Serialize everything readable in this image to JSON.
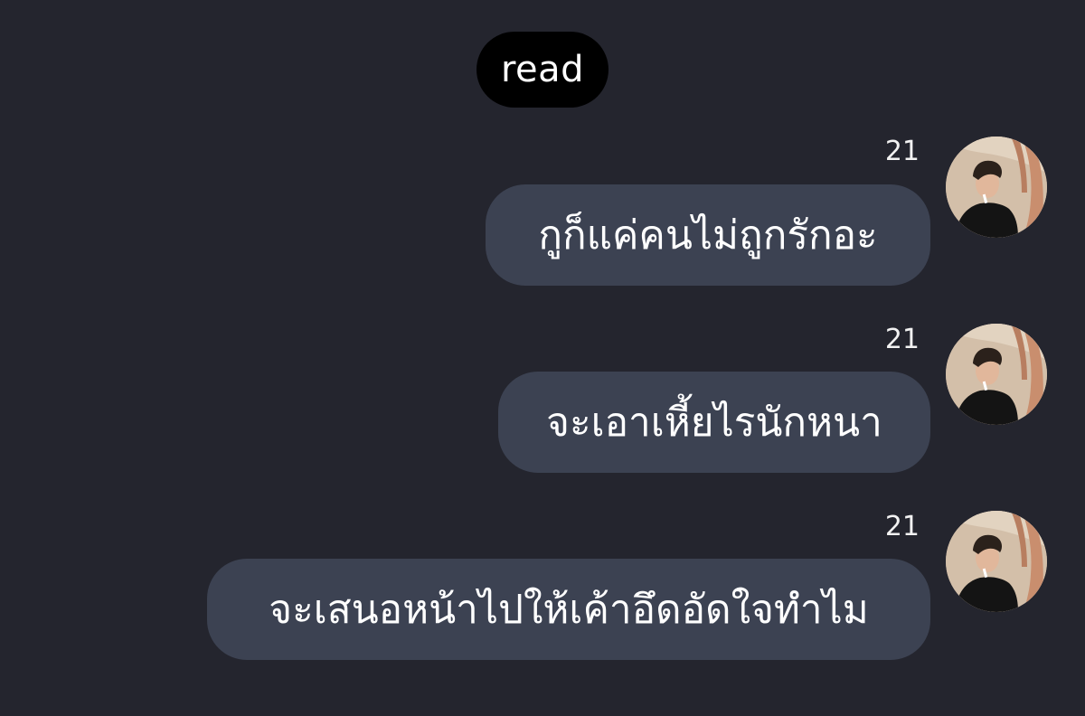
{
  "status": {
    "read_label": "read"
  },
  "messages": [
    {
      "sender": "21",
      "text": "กูก็แค่คนไม่ถูกรักอะ"
    },
    {
      "sender": "21",
      "text": "จะเอาเหี้ยไรนักหนา"
    },
    {
      "sender": "21",
      "text": "จะเสนอหน้าไปให้เค้าอึดอัดใจทำไม"
    }
  ],
  "colors": {
    "background": "#24252e",
    "bubble": "#3c4252",
    "read_pill": "#000000",
    "text": "#ffffff"
  },
  "icons": {
    "avatar": "profile-photo-avatar"
  }
}
